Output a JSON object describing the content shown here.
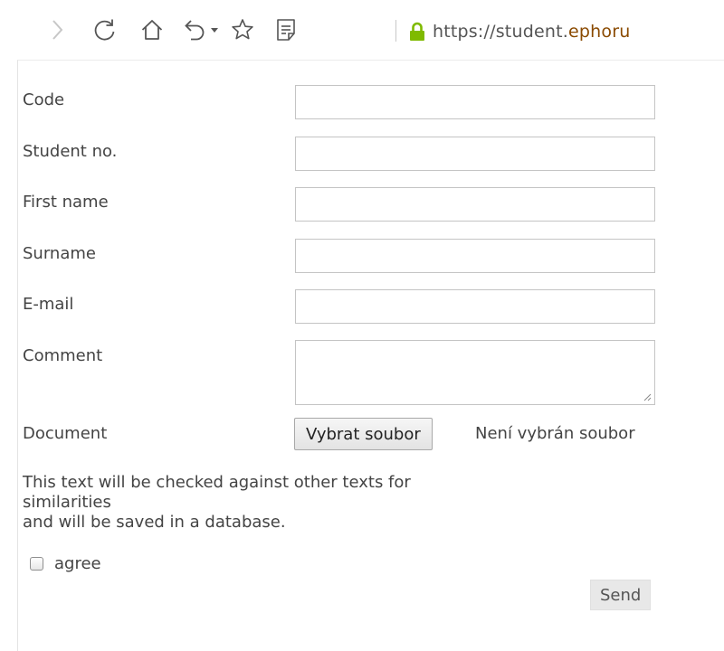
{
  "browser": {
    "url_prefix": "https://student.",
    "url_domain": "ephoru",
    "icons": [
      "forward-icon",
      "reload-icon",
      "home-icon",
      "undo-icon",
      "dropdown-arrow-icon",
      "star-icon",
      "reader-icon",
      "lock-icon"
    ],
    "lock_color": "#7fba00"
  },
  "form": {
    "fields": [
      {
        "label": "Code",
        "value": ""
      },
      {
        "label": "Student no.",
        "value": ""
      },
      {
        "label": "First name",
        "value": ""
      },
      {
        "label": "Surname",
        "value": ""
      },
      {
        "label": "E-mail",
        "value": ""
      }
    ],
    "comment": {
      "label": "Comment",
      "value": ""
    },
    "document": {
      "label": "Document",
      "button_label": "Vybrat soubor",
      "status_text": "Není vybrán soubor"
    },
    "notice_line1": "This text will be checked against other texts for similarities",
    "notice_line2": "and will be saved in a database.",
    "agree_label": "agree",
    "agree_checked": false,
    "send_label": "Send"
  }
}
